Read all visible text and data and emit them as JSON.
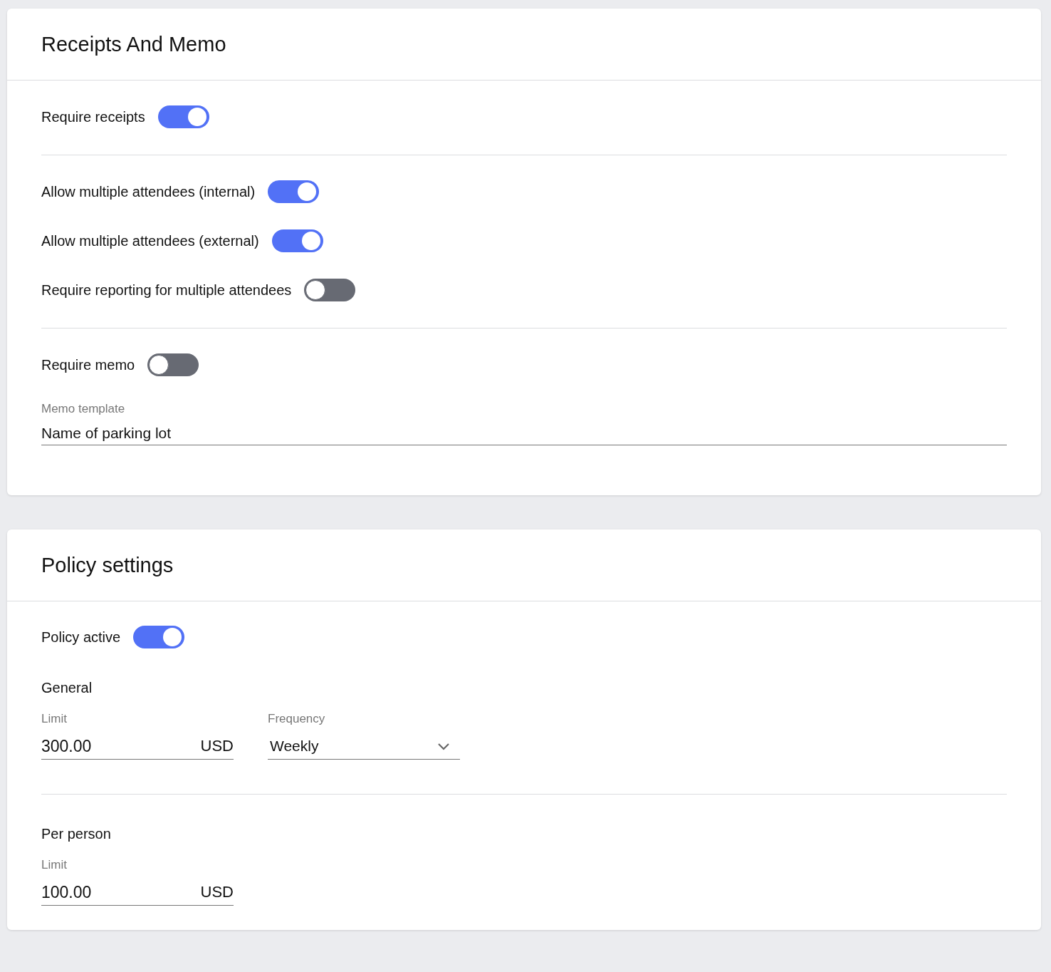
{
  "receipts_card": {
    "title": "Receipts And Memo",
    "toggle_groups": [
      [
        {
          "label": "Require receipts",
          "on": true
        }
      ],
      [
        {
          "label": "Allow multiple attendees (internal)",
          "on": true
        },
        {
          "label": "Allow multiple attendees (external)",
          "on": true
        },
        {
          "label": "Require reporting for multiple attendees",
          "on": false
        }
      ],
      [
        {
          "label": "Require memo",
          "on": false
        }
      ]
    ],
    "memo_field": {
      "label": "Memo template",
      "value": "Name of parking lot"
    }
  },
  "policy_card": {
    "title": "Policy settings",
    "toggle": {
      "label": "Policy active",
      "on": true
    },
    "sections": [
      {
        "heading": "General",
        "fields": [
          {
            "kind": "amount",
            "label": "Limit",
            "value": "300.00",
            "unit": "USD"
          },
          {
            "kind": "select",
            "label": "Frequency",
            "value": "Weekly"
          }
        ]
      },
      {
        "heading": "Per person",
        "fields": [
          {
            "kind": "amount",
            "label": "Limit",
            "value": "100.00",
            "unit": "USD"
          }
        ]
      }
    ]
  }
}
